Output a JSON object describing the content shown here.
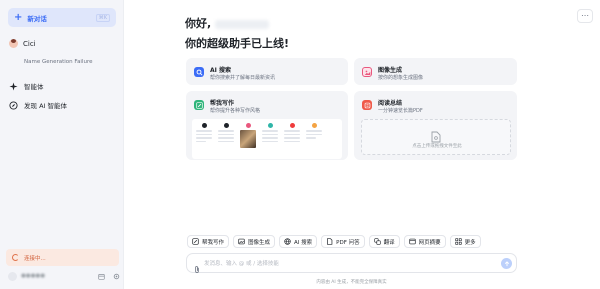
{
  "sidebar": {
    "new_chat_label": "新对话",
    "new_chat_shortcut": "⌘K",
    "bot_name": "Cici",
    "session_title": "Name Generation Failure",
    "nav": [
      {
        "label": "智能体",
        "icon": "sparkle-icon"
      },
      {
        "label": "发现 AI 智能体",
        "icon": "compass-icon"
      }
    ],
    "status_text": "连接中...",
    "accent_color": "#3b6cf6",
    "status_color": "#d2603a"
  },
  "main": {
    "greeting_prefix": "你好,",
    "greeting_line2": "你的超级助手已上线!",
    "cards": [
      {
        "title": "AI 搜索",
        "desc": "帮你搜索并了解每日最新资讯",
        "icon": "search-icon",
        "color": "#3b6cf6"
      },
      {
        "title": "图像生成",
        "desc": "按你的想象生成图像",
        "icon": "image-icon",
        "color": "#e9587e"
      },
      {
        "title": "帮我写作",
        "desc": "帮你提升各种写作风格",
        "icon": "pen-icon",
        "color": "#2fb57a"
      },
      {
        "title": "阅读总结",
        "desc": "一分钟速览长篇PDF",
        "icon": "book-icon",
        "color": "#ef5a4a"
      }
    ],
    "upload_hint": "点击上传或拖拽文件至此"
  },
  "toolbar": {
    "tools": [
      {
        "label": "帮我写作",
        "icon": "pen-icon"
      },
      {
        "label": "图像生成",
        "icon": "image-icon"
      },
      {
        "label": "AI 搜索",
        "icon": "globe-icon"
      },
      {
        "label": "PDF 问答",
        "icon": "pdf-icon"
      },
      {
        "label": "翻译",
        "icon": "translate-icon"
      },
      {
        "label": "网页摘要",
        "icon": "web-icon"
      },
      {
        "label": "更多",
        "icon": "grid-icon"
      }
    ]
  },
  "composer": {
    "placeholder": "发消息、输入 @ 或 / 选择技能",
    "value": ""
  },
  "footer": {
    "disclaimer": "内容由 AI 生成，不能完全保障真实"
  }
}
